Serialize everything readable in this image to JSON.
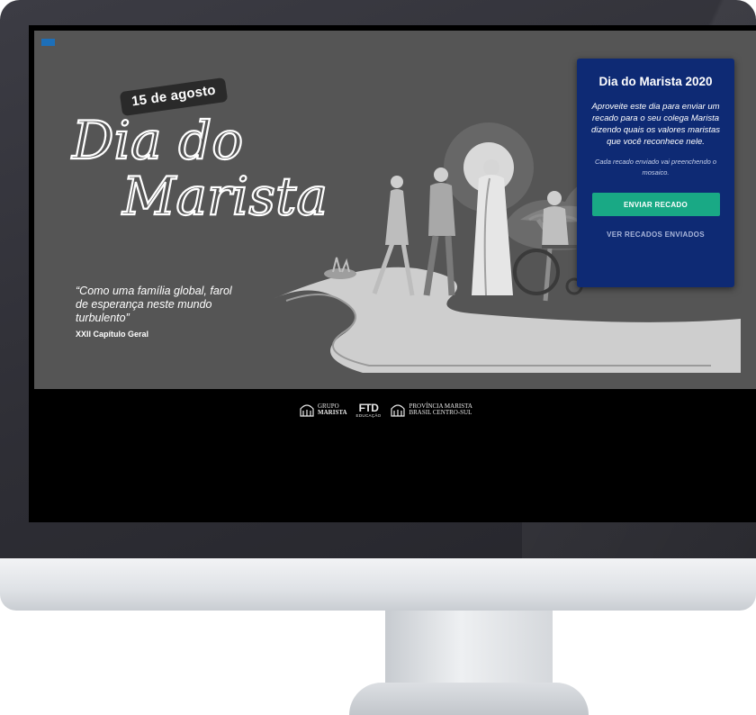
{
  "hero": {
    "date_badge": "15 de agosto",
    "title": "Dia do Marista",
    "quote": "“Como uma família global, farol de esperança neste mundo turbulento”",
    "quote_source": "XXII Capítulo Geral"
  },
  "card": {
    "title": "Dia do Marista 2020",
    "text": "Aproveite este dia para enviar um recado para o seu colega Marista dizendo quais os valores maristas que você reconhece nele.",
    "note": "Cada recado enviado vai preenchendo o mosaico.",
    "send_button": "ENVIAR RECADO",
    "sent_link": "VER RECADOS ENVIADOS"
  },
  "footer": {
    "logo1_line1": "GRUPO",
    "logo1_line2": "MARISTA",
    "logo2_main": "FTD",
    "logo2_sub": "EDUCAÇÃO",
    "logo3_line1": "PROVÍNCIA MARISTA",
    "logo3_line2": "BRASIL CENTRO-SUL"
  },
  "colors": {
    "card_bg": "#0e2a74",
    "button": "#19a985",
    "hero_bg": "#555555"
  }
}
